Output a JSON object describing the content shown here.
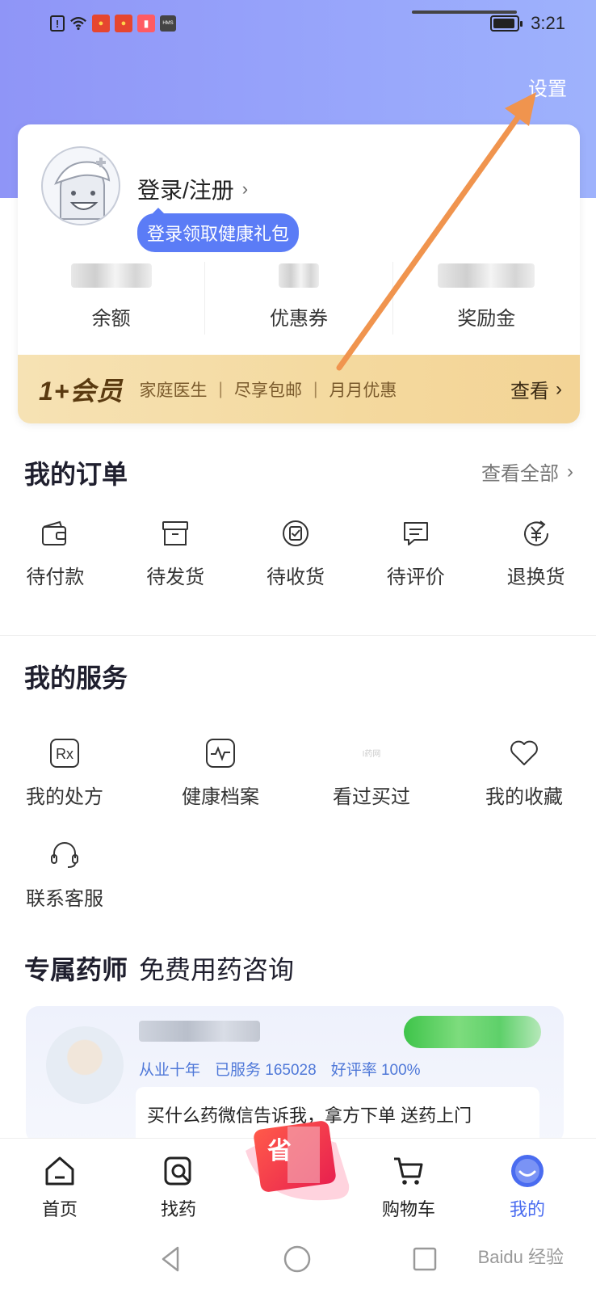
{
  "status_bar": {
    "time": "3:21",
    "icons": [
      "alert-icon",
      "wifi-icon",
      "red-packet-icon",
      "red-packet-icon",
      "book-icon",
      "hms-icon"
    ]
  },
  "header": {
    "settings_label": "设置"
  },
  "user_card": {
    "login_label": "登录/注册",
    "gift_tip": "登录领取健康礼包",
    "stats": [
      {
        "label": "余额"
      },
      {
        "label": "优惠券"
      },
      {
        "label": "奖励金"
      }
    ],
    "vip": {
      "logo": "1+会员",
      "benefits": [
        "家庭医生",
        "尽享包邮",
        "月月优惠"
      ],
      "view_label": "查看"
    }
  },
  "orders": {
    "title": "我的订单",
    "see_all": "查看全部",
    "items": [
      {
        "label": "待付款",
        "icon": "wallet-icon"
      },
      {
        "label": "待发货",
        "icon": "box-icon"
      },
      {
        "label": "待收货",
        "icon": "receive-icon"
      },
      {
        "label": "待评价",
        "icon": "comment-icon"
      },
      {
        "label": "退换货",
        "icon": "refund-icon"
      }
    ]
  },
  "services": {
    "title": "我的服务",
    "items": [
      {
        "label": "我的处方",
        "icon": "rx-icon"
      },
      {
        "label": "健康档案",
        "icon": "health-record-icon"
      },
      {
        "label": "看过买过",
        "icon": "history-icon"
      },
      {
        "label": "我的收藏",
        "icon": "heart-icon"
      },
      {
        "label": "联系客服",
        "icon": "headset-icon"
      }
    ]
  },
  "pharmacist": {
    "title_bold": "专属药师",
    "title_rest": "免费用药咨询",
    "meta": [
      "从业十年",
      "已服务 165028",
      "好评率 100%"
    ],
    "message": "买什么药微信告诉我，拿方下单 送药上门"
  },
  "tabbar": {
    "items": [
      {
        "label": "首页",
        "icon": "home-icon",
        "active": false
      },
      {
        "label": "找药",
        "icon": "find-medicine-icon",
        "active": false
      },
      {
        "label": "购物车",
        "icon": "cart-icon",
        "active": false
      },
      {
        "label": "我的",
        "icon": "profile-icon",
        "active": true
      }
    ],
    "promo_text": "省"
  },
  "colors": {
    "accent": "#4a6cf0",
    "hero_gradient": [
      "#8f95f7",
      "#9eb2fc"
    ],
    "vip_gold": "#f4d99e",
    "annotation_arrow": "#f0944e"
  },
  "watermark": "Baidu 经验"
}
